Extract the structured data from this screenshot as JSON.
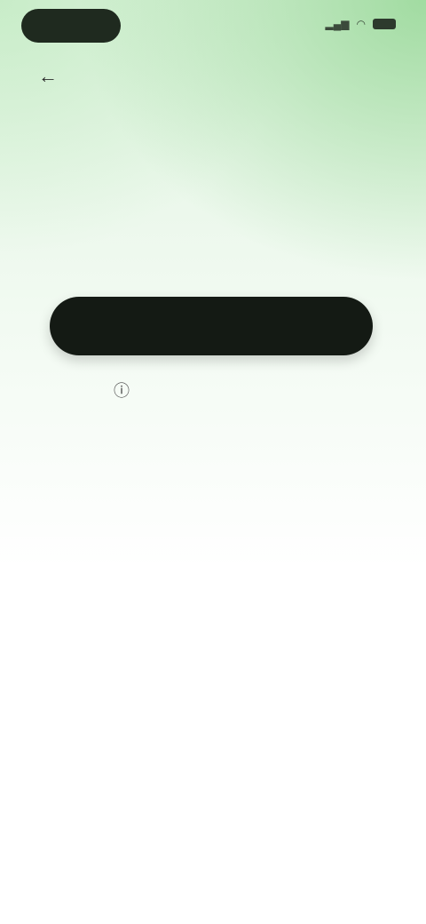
{
  "status_bar": {
    "time": "",
    "icons": [
      "signal-icon",
      "wifi-icon",
      "battery-icon"
    ]
  },
  "nav": {
    "back_icon": "back-arrow-icon",
    "title": ""
  },
  "main": {
    "headline": "",
    "subtext": "",
    "note": ""
  },
  "actions": {
    "primary_label": "",
    "secondary_label": "",
    "secondary_icon": "info-icon"
  },
  "legal": {
    "text": ""
  },
  "colors": {
    "accent": "#96d796",
    "button_bg": "#141a14"
  }
}
